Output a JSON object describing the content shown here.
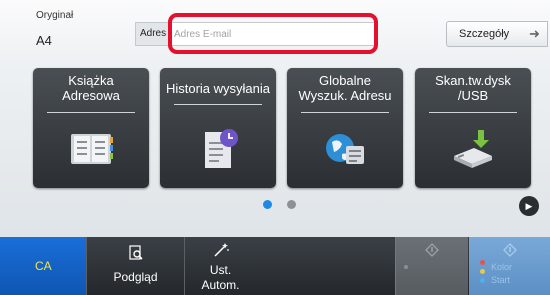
{
  "header": {
    "original_label": "Oryginał",
    "original_value": "A4",
    "address_label": "Adres",
    "address_placeholder": "Adres E-mail",
    "details_button": "Szczegóły"
  },
  "tiles": [
    {
      "line1": "Książka",
      "line2": "Adresowa",
      "icon": "address-book-icon"
    },
    {
      "line1": "Historia wysyłania",
      "line2": "",
      "icon": "history-clock-icon"
    },
    {
      "line1": "Globalne",
      "line2": "Wyszuk. Adresu",
      "icon": "globe-search-icon"
    },
    {
      "line1": "Skan.tw.dysk",
      "line2": "/USB",
      "icon": "usb-drive-icon"
    }
  ],
  "pager": {
    "pages": 2,
    "current": 1
  },
  "bottom": {
    "ca_label": "CA",
    "preview_label": "Podgląd",
    "auto_line1": "Ust.",
    "auto_line2": "Autom.",
    "color_start_line1": "Kolor",
    "color_start_line2": "Start"
  },
  "colors": {
    "highlight": "#e3102e",
    "ca_button": "#1a6ed8",
    "pager_active": "#1e88e5",
    "tile_bg": "#3a3f44"
  }
}
